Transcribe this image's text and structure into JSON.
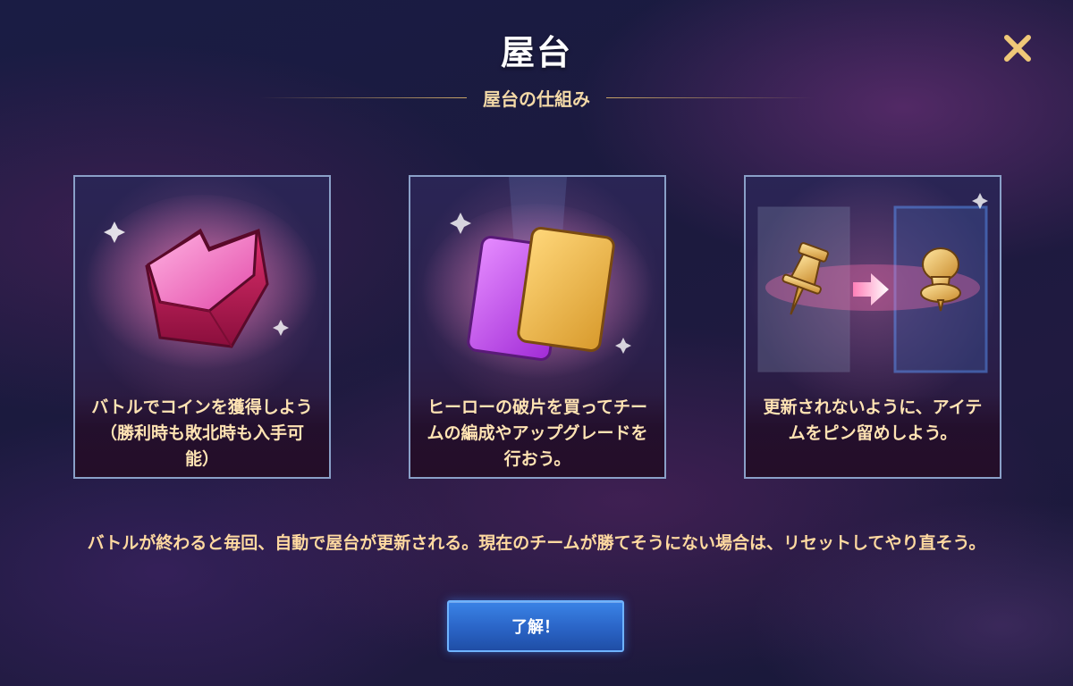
{
  "header": {
    "title": "屋台",
    "subtitle": "屋台の仕組み"
  },
  "cards": [
    {
      "text": "バトルでコインを獲得しよう（勝利時も敗北時も入手可能）",
      "icon": "coin-gem-icon"
    },
    {
      "text": "ヒーローの破片を買ってチームの編成やアップグレードを行おう。",
      "icon": "hero-shards-icon"
    },
    {
      "text": "更新されないように、アイテムをピン留めしよう。",
      "icon": "pin-item-icon"
    }
  ],
  "description": "バトルが終わると毎回、自動で屋台が更新される。現在のチームが勝てそうにない場合は、リセットしてやり直そう。",
  "buttons": {
    "ok_label": "了解！"
  },
  "colors": {
    "accent_gold": "#f3d9a7",
    "button_blue": "#2a64c6",
    "card_border": "#8aa0c8"
  }
}
